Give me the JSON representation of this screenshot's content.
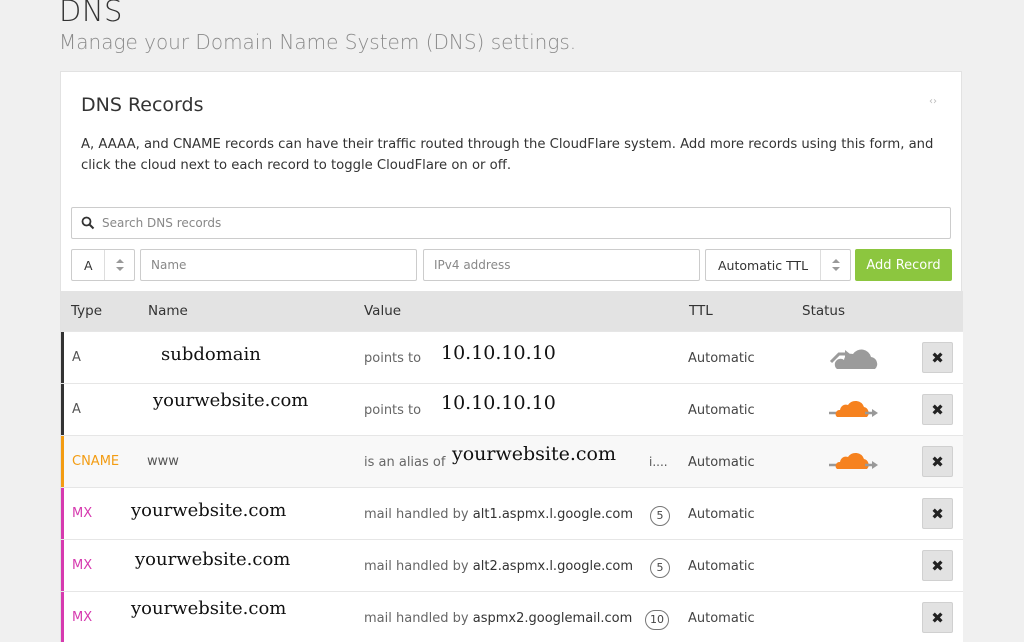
{
  "page": {
    "title": "DNS",
    "subtitle": "Manage your Domain Name System (DNS) settings."
  },
  "card": {
    "title": "DNS Records",
    "description": "A, AAAA, and CNAME records can have their traffic routed through the CloudFlare system. Add more records using this form, and click the cloud next to each record to toggle CloudFlare on or off.",
    "expand_icon": "‹›"
  },
  "search": {
    "placeholder": "Search DNS records"
  },
  "form": {
    "type_value": "A",
    "name_placeholder": "Name",
    "value_placeholder": "IPv4 address",
    "ttl_value": "Automatic TTL",
    "add_label": "Add Record"
  },
  "table": {
    "headers": {
      "type": "Type",
      "name": "Name",
      "value": "Value",
      "ttl": "TTL",
      "status": "Status"
    },
    "rows": [
      {
        "type": "A",
        "name": "subdomain",
        "value_label": "points to",
        "value": "10.10.10.10",
        "ttl": "Automatic",
        "status": "cloud-off",
        "delete": "✖"
      },
      {
        "type": "A",
        "name": "yourwebsite.com",
        "value_label": "points to",
        "value": "10.10.10.10",
        "ttl": "Automatic",
        "status": "cloud-on",
        "delete": "✖"
      },
      {
        "type": "CNAME",
        "name": "www",
        "value_label": "is an alias of",
        "value": "yourwebsite.com",
        "value_trunc": "i....",
        "ttl": "Automatic",
        "status": "cloud-on",
        "delete": "✖"
      },
      {
        "type": "MX",
        "name": "yourwebsite.com",
        "value_label": "mail handled by",
        "value": "alt1.aspmx.l.google.com",
        "priority": "5",
        "ttl": "Automatic",
        "delete": "✖"
      },
      {
        "type": "MX",
        "name": "yourwebsite.com",
        "value_label": "mail handled by",
        "value": "alt2.aspmx.l.google.com",
        "priority": "5",
        "ttl": "Automatic",
        "delete": "✖"
      },
      {
        "type": "MX",
        "name": "yourwebsite.com",
        "value_label": "mail handled by",
        "value": "aspmx2.googlemail.com",
        "priority": "10",
        "ttl": "Automatic",
        "delete": "✖"
      }
    ]
  },
  "colors": {
    "accent_green": "#8cc63f",
    "cloud_orange": "#f6821f",
    "cloud_grey": "#9b9b9b",
    "type_a": "#333333",
    "type_cname": "#f39c12",
    "type_mx": "#d63aaf"
  }
}
